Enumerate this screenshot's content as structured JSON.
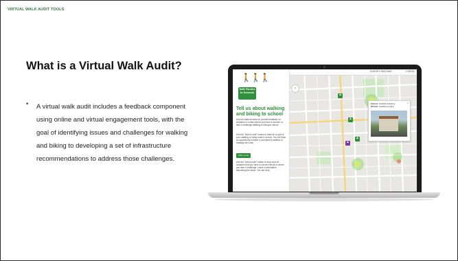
{
  "header": {
    "section_label": "VIRTUAL WALK AUDIT TOOLS"
  },
  "main": {
    "title": "What is a Virtual Walk Audit?",
    "bullets": [
      "A virtual walk audit includes a feedback component using online and virtual engagement tools, with the goal of identifying issues and challenges for walking and biking to developing a set of infrastructure recommendations to address those challenges."
    ]
  },
  "screenshot": {
    "logo_text": "Safe Routes to Schools",
    "panel_heading": "Tell us about walking and biking to school",
    "panel_paragraphs": [
      "Use the buttons below to provide feedback on locations or routes where you have a concern or face a challenge walking or biking to school.",
      "Use the \"Add a route\" button to draw all or part of your walking or riding route to school. You will have an opportunity to leave a comment in addition to drawing the route.",
      "Use the \"Add a point\" button to drop a pin at locations that you have a concern about or where you face a challenge. Leave a description describing the issue. You can drop"
    ],
    "add_route_button": "Add a route",
    "topbar_items": [
      "SURVEY AND MAP",
      "CONTA"
    ],
    "info_card": {
      "school_label": "School:",
      "school_value": "Garfield Academy",
      "district_label": "District:",
      "district_value": "Oakland Unified"
    },
    "accent_color": "#2f8f3a"
  }
}
